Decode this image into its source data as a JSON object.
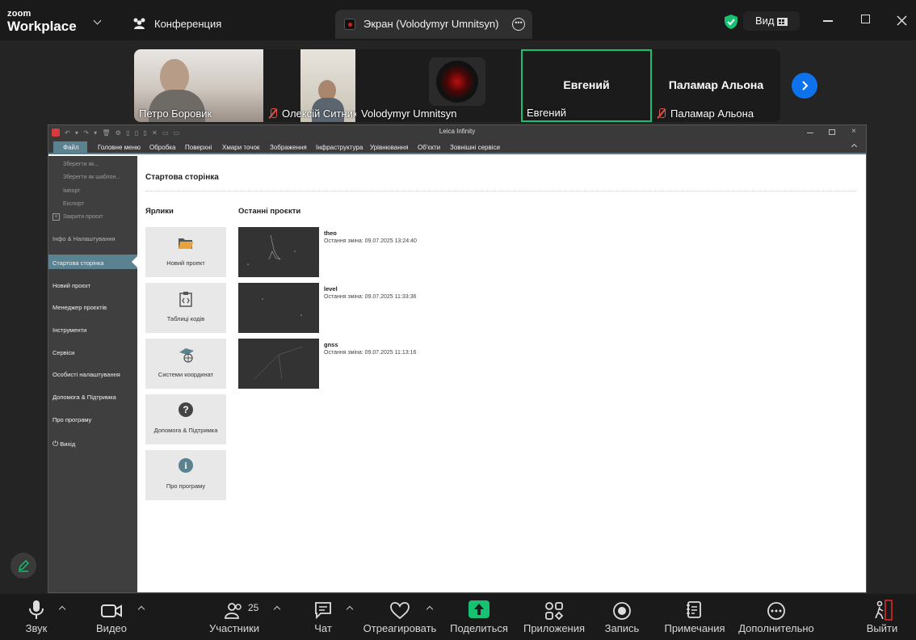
{
  "app": {
    "logo_line1": "zoom",
    "logo_line2": "Workplace",
    "meeting_tab": "Конференция",
    "screen_tab": "Экран (Volodymyr Umnitsyn)",
    "view_label": "Вид",
    "accent_green": "#16c172",
    "accent_blue": "#0e72ed"
  },
  "participants": [
    {
      "name": "Петро Боровик",
      "muted": false
    },
    {
      "name": "Олексій Ситник",
      "muted": true
    },
    {
      "name": "Volodymyr Umnitsyn",
      "muted": false
    },
    {
      "name": "Евгений",
      "muted": false,
      "center_name": "Евгений",
      "active_speaker": true
    },
    {
      "name": "Паламар Альона",
      "muted": true,
      "center_name": "Паламар Альона"
    }
  ],
  "leica": {
    "title": "Leica Infinity",
    "menu": [
      "Файл",
      "Головне меню",
      "Обробка",
      "Поверхні",
      "Хмари точок",
      "Зображення",
      "Інфраструктура",
      "Урівнювання",
      "Об'єкти",
      "Зовнішні сервіси"
    ],
    "sidebar_small": [
      "Зберегти як...",
      "Зберегти як шаблон...",
      "Імпорт",
      "Експорт",
      "Закрити проєкт"
    ],
    "sidebar_info": "Інфо & Налаштування",
    "sidebar_active": "Стартова сторінка",
    "sidebar_items": [
      "Новий проєкт",
      "Менеджер проєктів",
      "Інструменти",
      "Сервіси",
      "Особисті налаштування",
      "Допомога & Підтримка",
      "Про програму"
    ],
    "sidebar_exit": "Вихід",
    "page_title": "Стартова сторінка",
    "shortcuts_header": "Ярлики",
    "shortcuts": [
      "Новий проект",
      "Таблиці кодів",
      "Системи координат",
      "Допомога & Підтримка",
      "Про програму"
    ],
    "recent_header": "Останні проєкти",
    "recent": [
      {
        "name": "theo",
        "date": "Остання зміна: 09.07.2025 13:24:40"
      },
      {
        "name": "level",
        "date": "Остання зміна: 09.07.2025 11:33:36"
      },
      {
        "name": "gnss",
        "date": "Остання зміна: 09.07.2025 11:13:16"
      }
    ]
  },
  "toolbar": {
    "audio": "Звук",
    "video": "Видео",
    "participants": "Участники",
    "participants_count": "25",
    "chat": "Чат",
    "react": "Отреагировать",
    "share": "Поделиться",
    "apps": "Приложения",
    "record": "Запись",
    "notes": "Примечания",
    "more": "Дополнительно",
    "leave": "Выйти"
  }
}
